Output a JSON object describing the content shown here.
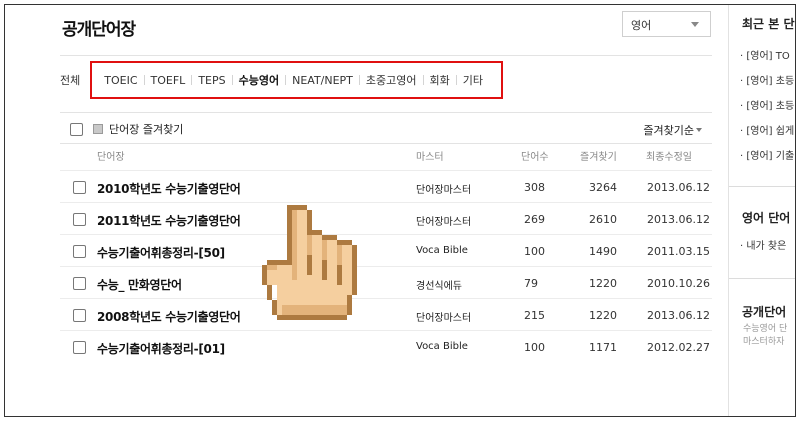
{
  "header": {
    "title": "공개단어장",
    "language_select": "영어"
  },
  "filters": {
    "all_label": "전체",
    "items": [
      {
        "label": "TOEIC",
        "active": false
      },
      {
        "label": "TOEFL",
        "active": false
      },
      {
        "label": "TEPS",
        "active": false
      },
      {
        "label": "수능영어",
        "active": true
      },
      {
        "label": "NEAT/NEPT",
        "active": false
      },
      {
        "label": "초중고영어",
        "active": false
      },
      {
        "label": "회화",
        "active": false
      },
      {
        "label": "기타",
        "active": false
      }
    ],
    "highlight_color": "#e01010"
  },
  "favorites_bar": {
    "label": "단어장 즐겨찾기",
    "sort_label": "즐겨찾기순"
  },
  "table": {
    "columns": [
      "단어장",
      "마스터",
      "단어수",
      "즐겨찾기",
      "최종수정일"
    ],
    "rows": [
      {
        "name": "2010학년도 수능기출영단어",
        "master": "단어장마스터",
        "count": "308",
        "fav": "3264",
        "date": "2013.06.12"
      },
      {
        "name": "2011학년도 수능기출영단어",
        "master": "단어장마스터",
        "count": "269",
        "fav": "2610",
        "date": "2013.06.12"
      },
      {
        "name": "수능기출어휘총정리-[50]",
        "master": "Voca Bible",
        "count": "100",
        "fav": "1490",
        "date": "2011.03.15"
      },
      {
        "name": "수능_ 만화영단어",
        "master": "경선식에듀",
        "count": "79",
        "fav": "1220",
        "date": "2010.10.26"
      },
      {
        "name": "2008학년도 수능기출영단어",
        "master": "단어장마스터",
        "count": "215",
        "fav": "1220",
        "date": "2013.06.12"
      },
      {
        "name": "수능기출어휘총정리-[01]",
        "master": "Voca Bible",
        "count": "100",
        "fav": "1171",
        "date": "2012.02.27"
      }
    ]
  },
  "sidebar": {
    "recent_title": "최근 본 단",
    "recent_items": [
      "· [영어] TO",
      "· [영어] 초등",
      "· [영어] 초등",
      "· [영어] 쉽게",
      "· [영어] 기출"
    ],
    "wordbook_title": "영어 단어",
    "wordbook_item": "· 내가 찾은",
    "public_title": "공개단어",
    "public_desc_1": "수능영어 단",
    "public_desc_2": "마스터하자"
  },
  "cursor_icon": "hand-pointer-icon"
}
